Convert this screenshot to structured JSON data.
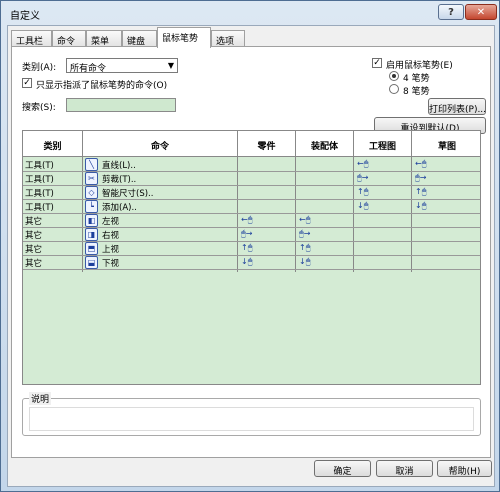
{
  "window": {
    "title": "自定义"
  },
  "tabs": [
    "工具栏",
    "命令",
    "菜单",
    "键盘",
    "鼠标笔势",
    "选项"
  ],
  "category": {
    "label": "类别(A):",
    "value": "所有命令"
  },
  "only_assigned": {
    "label": "只显示指派了鼠标笔势的命令(O)"
  },
  "search": {
    "label": "搜索(S):",
    "value": ""
  },
  "enable_gestures": {
    "label": "启用鼠标笔势(E)"
  },
  "gesture_options": [
    "4 笔势",
    "8 笔势"
  ],
  "buttons": {
    "print_list": "打印列表(P)...",
    "reset_default": "重设到默认(D)",
    "ok": "确定",
    "cancel": "取消",
    "help": "帮助(H)"
  },
  "table": {
    "columns": [
      "类别",
      "命令",
      "零件",
      "装配体",
      "工程图",
      "草图"
    ],
    "rows": [
      {
        "category": "工具(T)",
        "icon": "line-icon",
        "command": "直线(L)..",
        "part": "",
        "assembly": "",
        "drawing": "←🖱",
        "sketch": "←🖱"
      },
      {
        "category": "工具(T)",
        "icon": "trim-icon",
        "command": "剪裁(T)..",
        "part": "",
        "assembly": "",
        "drawing": "🖱→",
        "sketch": "🖱→"
      },
      {
        "category": "工具(T)",
        "icon": "smart-dimension-icon",
        "command": "智能尺寸(S)..",
        "part": "",
        "assembly": "",
        "drawing": "↑🖱",
        "sketch": "↑🖱"
      },
      {
        "category": "工具(T)",
        "icon": "add-icon",
        "command": "添加(A)..",
        "part": "",
        "assembly": "",
        "drawing": "↓🖱",
        "sketch": "↓🖱"
      },
      {
        "category": "其它",
        "icon": "left-view-icon",
        "command": "左视",
        "part": "←🖱",
        "assembly": "←🖱",
        "drawing": "",
        "sketch": ""
      },
      {
        "category": "其它",
        "icon": "right-view-icon",
        "command": "右视",
        "part": "🖱→",
        "assembly": "🖱→",
        "drawing": "",
        "sketch": ""
      },
      {
        "category": "其它",
        "icon": "top-view-icon",
        "command": "上视",
        "part": "↑🖱",
        "assembly": "↑🖱",
        "drawing": "",
        "sketch": ""
      },
      {
        "category": "其它",
        "icon": "bottom-view-icon",
        "command": "下视",
        "part": "↓🖱",
        "assembly": "↓🖱",
        "drawing": "",
        "sketch": ""
      }
    ]
  },
  "description": {
    "label": "说明",
    "text": ""
  }
}
